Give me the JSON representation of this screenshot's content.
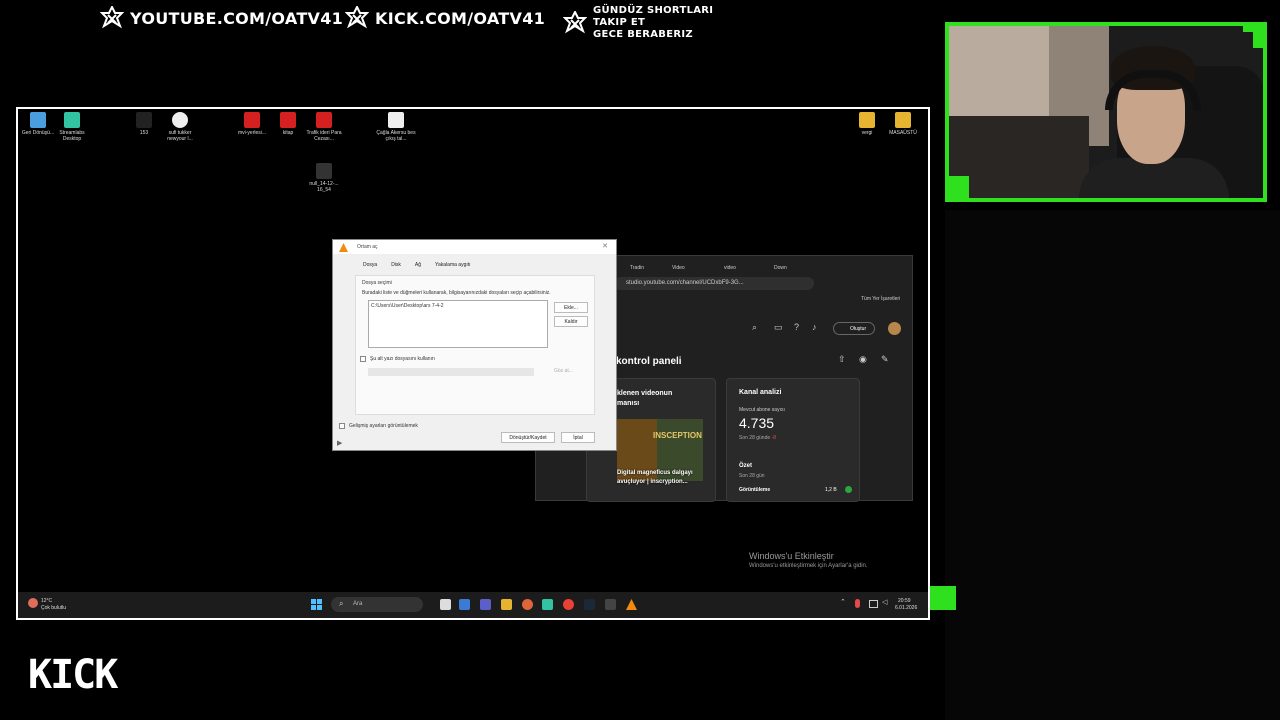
{
  "overlay": {
    "youtube": "YOUTUBE.COM/OATV41",
    "kick": "KICK.COM/OATV41",
    "line1": "GÜNDÜZ SHORTLARI",
    "line2": "TAKIP ET",
    "line3": "GECE BERABERIZ",
    "kick_logo": "KICK",
    "accent_color": "#2fe01f"
  },
  "desktop": {
    "icons": [
      {
        "label": "Geri Dönüşü...",
        "color": "#4a9ee0"
      },
      {
        "label": "Streamlabs Desktop",
        "color": "#31c3a2"
      },
      {
        "label": "153",
        "color": "#222"
      },
      {
        "label": "sufi tukker newyour l...",
        "color": "#eee"
      },
      {
        "label": "mvi-yerlesi...",
        "color": "#d42020"
      },
      {
        "label": "kitap",
        "color": "#d42020"
      },
      {
        "label": "Trafik ideri Para Cezası...",
        "color": "#d42020"
      },
      {
        "label": "Çağla Akersu bes çıkış tal...",
        "color": "#eee"
      },
      {
        "label": "vergi",
        "color": "#e7b431"
      },
      {
        "label": "MASAÜSTÜ",
        "color": "#e7b431"
      },
      {
        "label": "null_14-12-... 16_54",
        "color": "#333"
      }
    ],
    "activation_title": "Windows'u Etkinleştir",
    "activation_sub": "Windows'u etkinleştirmek için Ayarlar'a gidin."
  },
  "taskbar": {
    "weather_temp": "12°C",
    "weather_desc": "Çok bulutlu",
    "search_placeholder": "Ara",
    "time": "20:59",
    "date": "6.01.2026"
  },
  "browser": {
    "tabs": [
      "Tradin",
      "Video",
      "video",
      "Down"
    ],
    "url": "studio.youtube.com/channel/UCDxbF9-3G...",
    "bookmarks": "Tüm Yer İşaretleri",
    "create_button": "Oluştur",
    "dashboard_title": "kontrol paneli",
    "latest_title_1": "klenen videonun",
    "latest_title_2": "manısı",
    "thumbnail_text": "INSCEPTION",
    "video_title_1": "Digital magneficus dalgayı",
    "video_title_2": "avuçluyor | inscryption...",
    "analytics_title": "Kanal analizi",
    "subs_label": "Mevcut abone sayısı",
    "subs_value": "4.735",
    "subs_sub": "Son 28 günde",
    "subs_delta": "-8",
    "summary_label": "Özet",
    "summary_sub": "Son 28 gün",
    "views_label": "Görüntüleme",
    "views_value": "1,2 B"
  },
  "dialog": {
    "title": "Ortam aç",
    "tab_file": "Dosya",
    "tab_disc": "Disk",
    "tab_network": "Ağ",
    "tab_capture": "Yakalama aygıtı",
    "group_title": "Dosya seçimi",
    "instructions": "Buradaki liste ve düğmeleri kullanarak, bilgisayarınızdaki dosyaları seçip açabilirsiniz.",
    "file_path": "C:\\Users\\User\\Desktop\\ars 7-4-2",
    "add_button": "Ekle...",
    "remove_button": "Kaldır",
    "subtitle_checkbox": "Şu alt yazı dosyasını kullanın",
    "browse_button": "Göz at...",
    "advanced_checkbox": "Gelişmiş ayarları görüntülemek",
    "play_button": "Dönüştür/Kaydet",
    "cancel_button": "İptal"
  }
}
